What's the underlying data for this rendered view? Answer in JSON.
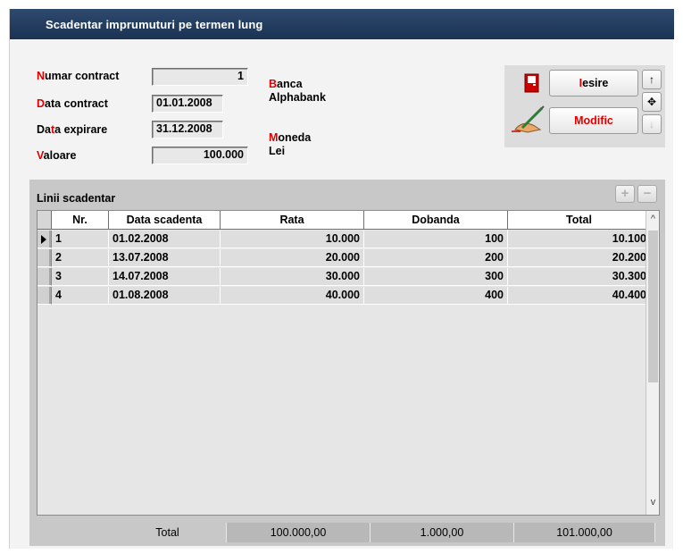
{
  "window": {
    "title": "Scadentar imprumuturi pe termen lung"
  },
  "form": {
    "numar_contract": {
      "hl": "N",
      "rest": "umar contract",
      "value": "1"
    },
    "data_contract": {
      "hl": "D",
      "rest": "ata contract",
      "value": "01.01.2008"
    },
    "data_expirare": {
      "pre": "Da",
      "hl": "t",
      "rest": "a expirare",
      "value": "31.12.2008"
    },
    "valoare": {
      "hl": "V",
      "rest": "aloare",
      "value": "100.000"
    },
    "banca": {
      "hl": "B",
      "rest": "anca",
      "value": "Alphabank"
    },
    "moneda": {
      "hl": "M",
      "rest": "oneda",
      "value": "Lei"
    }
  },
  "buttons": {
    "iesire": {
      "hl": "I",
      "rest": "esire"
    },
    "modific": {
      "label": "Modific"
    },
    "up_arrow": "↑",
    "move": "✥",
    "down_arrow": "↓",
    "exit_icon": "door-exit-icon",
    "edit_icon": "hand-pen-icon"
  },
  "grid": {
    "title": "Linii scadentar",
    "add": "+",
    "remove": "−",
    "columns": [
      "Nr.",
      "Data scadenta",
      "Rata",
      "Dobanda",
      "Total"
    ],
    "rows": [
      {
        "nr": "1",
        "data": "01.02.2008",
        "rata": "10.000",
        "dobanda": "100",
        "total": "10.100"
      },
      {
        "nr": "2",
        "data": "13.07.2008",
        "rata": "20.000",
        "dobanda": "200",
        "total": "20.200"
      },
      {
        "nr": "3",
        "data": "14.07.2008",
        "rata": "30.000",
        "dobanda": "300",
        "total": "30.300"
      },
      {
        "nr": "4",
        "data": "01.08.2008",
        "rata": "40.000",
        "dobanda": "400",
        "total": "40.400"
      }
    ],
    "totals": {
      "label": "Total",
      "rata": "100.000,00",
      "dobanda": "1.000,00",
      "total": "101.000,00"
    },
    "scroll_up": "^",
    "scroll_down": "v"
  },
  "colors": {
    "titlebar": "#1b3253",
    "hotkey": "#e00000",
    "panel": "#c8c8c8"
  }
}
